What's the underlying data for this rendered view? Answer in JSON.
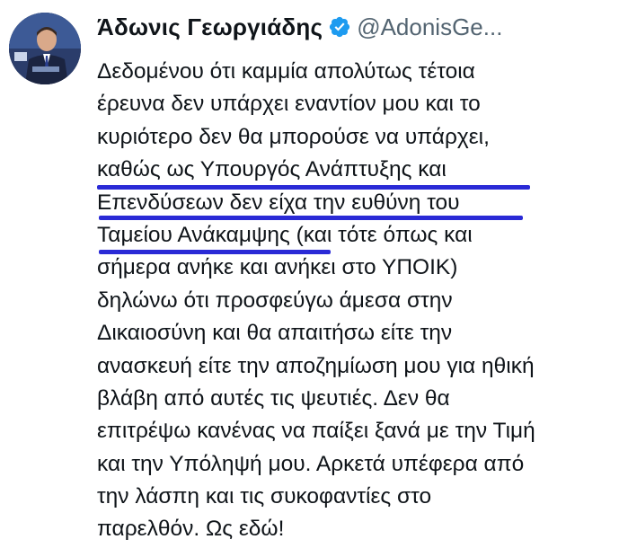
{
  "tweet": {
    "author": {
      "display_name": "Άδωνις Γεωργιάδης",
      "handle": "@AdonisGe...",
      "verified": true,
      "avatar_icon": "avatar-photo"
    },
    "lines": [
      "Δεδομένου ότι καμμία απολύτως τέτοια",
      "έρευνα δεν υπάρχει εναντίον μου και το",
      "κυριότερο δεν θα μπορούσε να υπάρχει,",
      "καθώς ως Υπουργός Ανάπτυξης και",
      "Επενδύσεων δεν είχα την ευθύνη του",
      "Ταμείου Ανάκαμψης (και τότε όπως και",
      "σήμερα ανήκε και ανήκει στο ΥΠΟΙΚ)",
      "δηλώνω ότι προσφεύγω άμεσα στην",
      "Δικαιοσύνη και θα απαιτήσω είτε την",
      "ανασκευή είτε την αποζημίωση μου για ηθική",
      "βλάβη από αυτές τις ψευτιές. Δεν θα",
      "επιτρέψω κανένας να παίξει ξανά με την Τιμή",
      "και την Υπόληψή μου. Αρκετά υπέφερα από",
      "την λάσπη και τις συκοφαντίες στο",
      "παρελθόν. Ως εδώ!"
    ]
  },
  "colors": {
    "text": "#0f1419",
    "secondary": "#536471",
    "verified": "#1d9bf0",
    "highlight_underline": "#2a2ad6"
  }
}
